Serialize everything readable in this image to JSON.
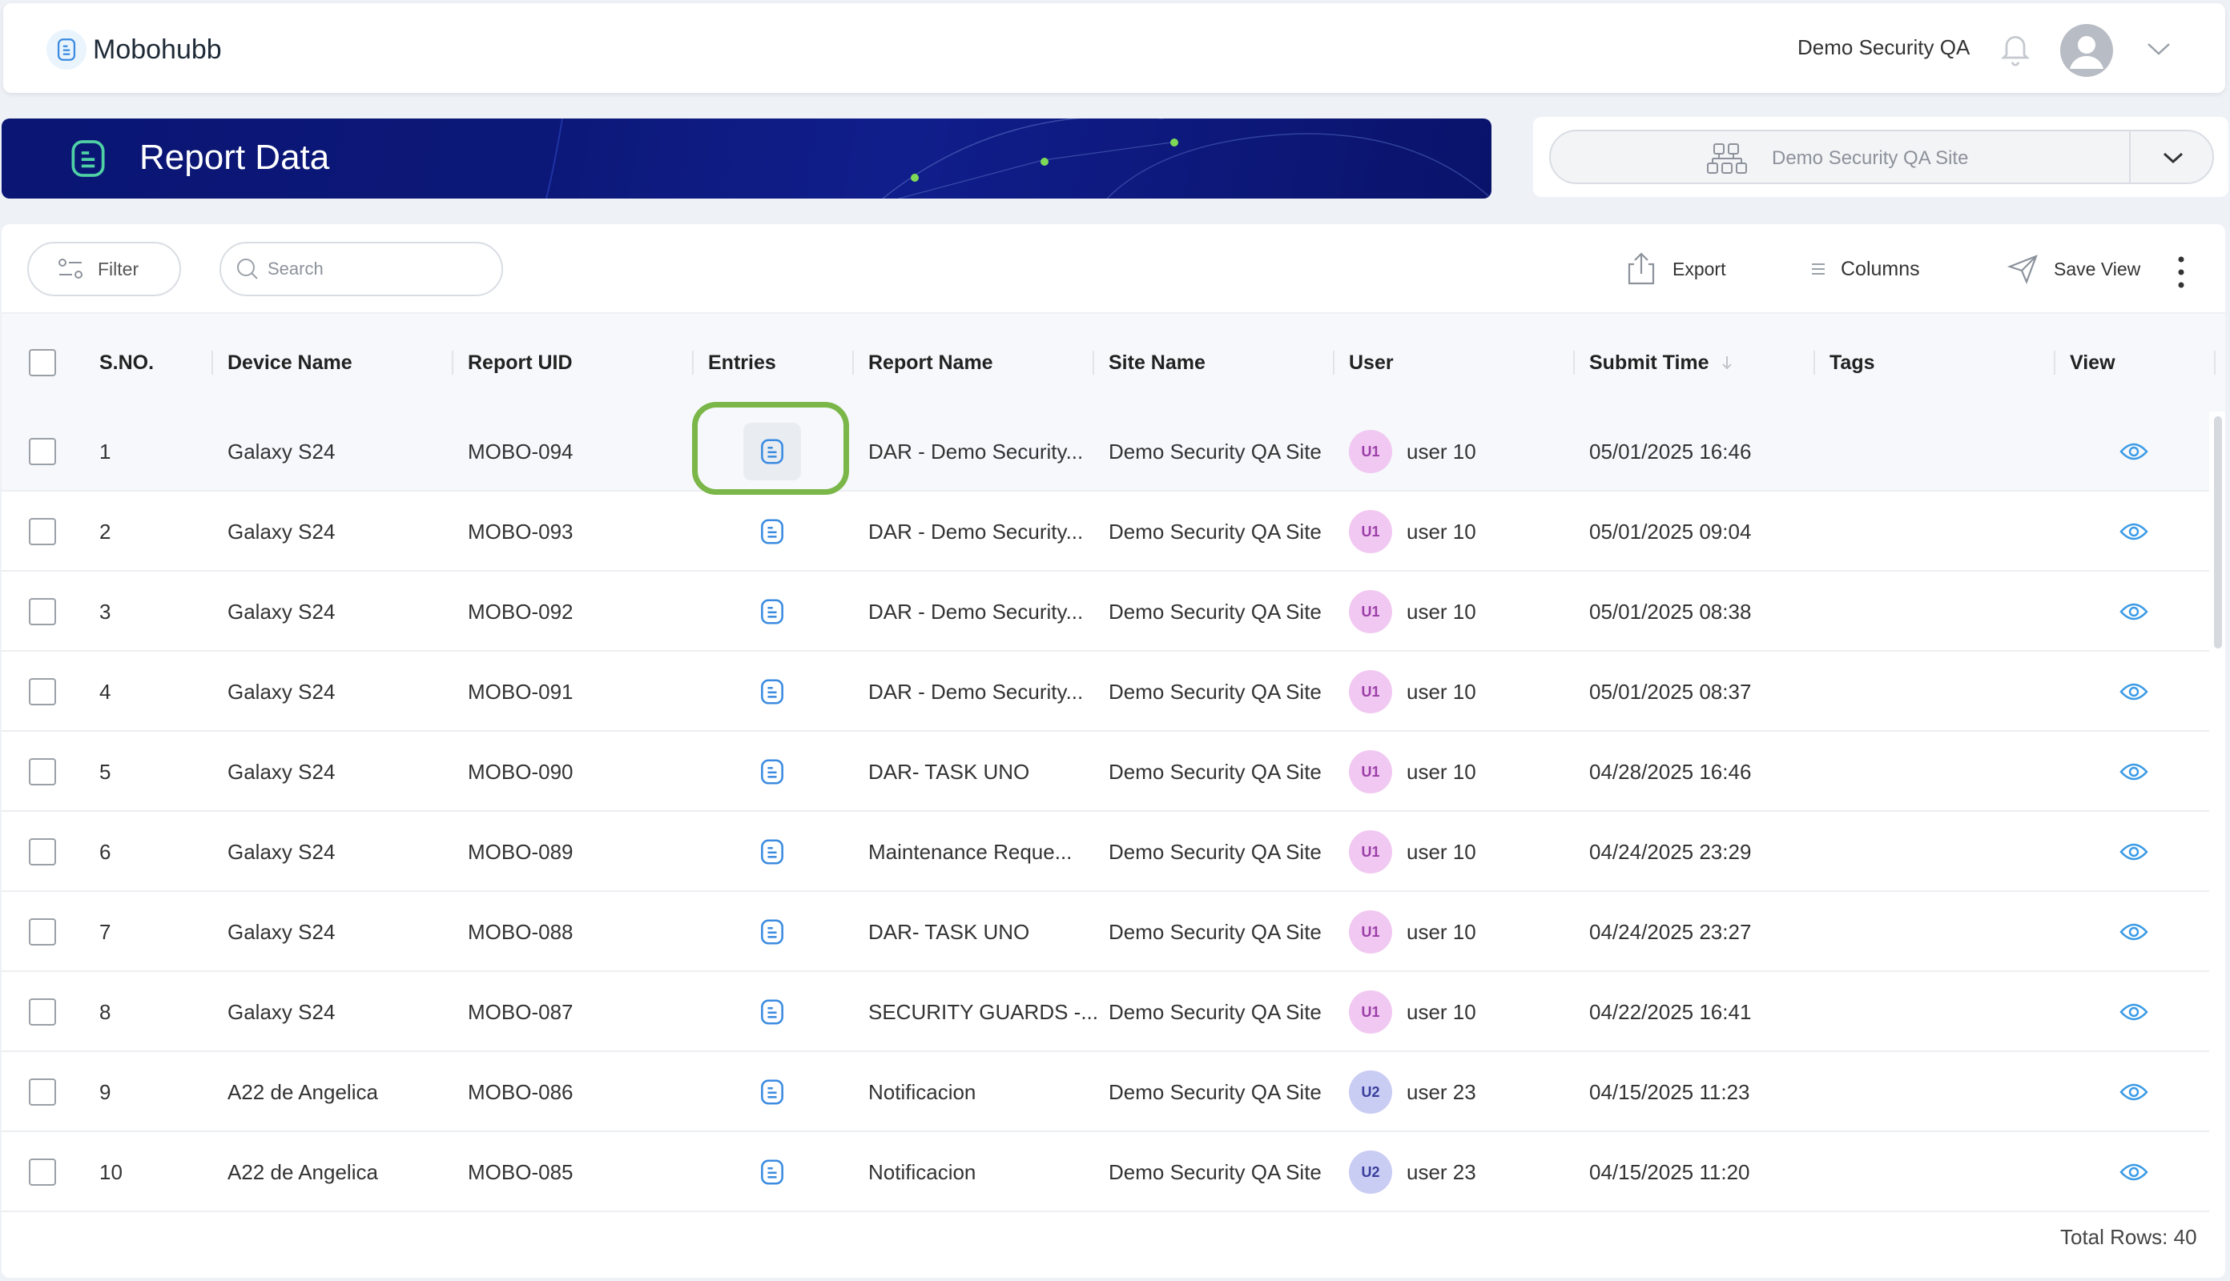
{
  "header": {
    "brand": "Mobohubb",
    "account_name": "Demo Security QA"
  },
  "banner": {
    "title": "Report Data"
  },
  "site_selector": {
    "selected": "Demo Security QA Site"
  },
  "toolbar": {
    "filter_label": "Filter",
    "search_placeholder": "Search",
    "export_label": "Export",
    "columns_label": "Columns",
    "save_view_label": "Save View"
  },
  "table": {
    "columns": {
      "sno": "S.NO.",
      "device": "Device Name",
      "uid": "Report UID",
      "entries": "Entries",
      "report": "Report Name",
      "site": "Site Name",
      "user": "User",
      "submit": "Submit Time",
      "tags": "Tags",
      "view": "View"
    },
    "rows": [
      {
        "sno": "1",
        "device": "Galaxy S24",
        "uid": "MOBO-094",
        "report": "DAR - Demo Security...",
        "site": "Demo Security QA Site",
        "badge": "U1",
        "user": "user 10",
        "submit": "05/01/2025 16:46"
      },
      {
        "sno": "2",
        "device": "Galaxy S24",
        "uid": "MOBO-093",
        "report": "DAR - Demo Security...",
        "site": "Demo Security QA Site",
        "badge": "U1",
        "user": "user 10",
        "submit": "05/01/2025 09:04"
      },
      {
        "sno": "3",
        "device": "Galaxy S24",
        "uid": "MOBO-092",
        "report": "DAR - Demo Security...",
        "site": "Demo Security QA Site",
        "badge": "U1",
        "user": "user 10",
        "submit": "05/01/2025 08:38"
      },
      {
        "sno": "4",
        "device": "Galaxy S24",
        "uid": "MOBO-091",
        "report": "DAR - Demo Security...",
        "site": "Demo Security QA Site",
        "badge": "U1",
        "user": "user 10",
        "submit": "05/01/2025 08:37"
      },
      {
        "sno": "5",
        "device": "Galaxy S24",
        "uid": "MOBO-090",
        "report": "DAR- TASK UNO",
        "site": "Demo Security QA Site",
        "badge": "U1",
        "user": "user 10",
        "submit": "04/28/2025 16:46"
      },
      {
        "sno": "6",
        "device": "Galaxy S24",
        "uid": "MOBO-089",
        "report": "Maintenance Reque...",
        "site": "Demo Security QA Site",
        "badge": "U1",
        "user": "user 10",
        "submit": "04/24/2025 23:29"
      },
      {
        "sno": "7",
        "device": "Galaxy S24",
        "uid": "MOBO-088",
        "report": "DAR- TASK UNO",
        "site": "Demo Security QA Site",
        "badge": "U1",
        "user": "user 10",
        "submit": "04/24/2025 23:27"
      },
      {
        "sno": "8",
        "device": "Galaxy S24",
        "uid": "MOBO-087",
        "report": "SECURITY GUARDS -...",
        "site": "Demo Security QA Site",
        "badge": "U1",
        "user": "user 10",
        "submit": "04/22/2025 16:41"
      },
      {
        "sno": "9",
        "device": "A22 de Angelica",
        "uid": "MOBO-086",
        "report": "Notificacion",
        "site": "Demo Security QA Site",
        "badge": "U2",
        "user": "user 23",
        "submit": "04/15/2025 11:23"
      },
      {
        "sno": "10",
        "device": "A22 de Angelica",
        "uid": "MOBO-085",
        "report": "Notificacion",
        "site": "Demo Security QA Site",
        "badge": "U2",
        "user": "user 23",
        "submit": "04/15/2025 11:20"
      }
    ]
  },
  "footer": {
    "total_rows": "Total Rows: 40"
  },
  "colors": {
    "banner": "#0a1574",
    "accent_blue": "#3b82f6",
    "badge_u1_bg": "#f1c8f1",
    "badge_u1_fg": "#9b3fa8",
    "badge_u2_bg": "#c9ccf3",
    "badge_u2_fg": "#3a3f9e",
    "highlight": "#7ab648"
  },
  "icons": {
    "brand": "document-lines-icon",
    "notification": "bell-icon",
    "profile": "user-avatar-icon",
    "entries": "document-lines-icon",
    "view": "eye-icon"
  }
}
